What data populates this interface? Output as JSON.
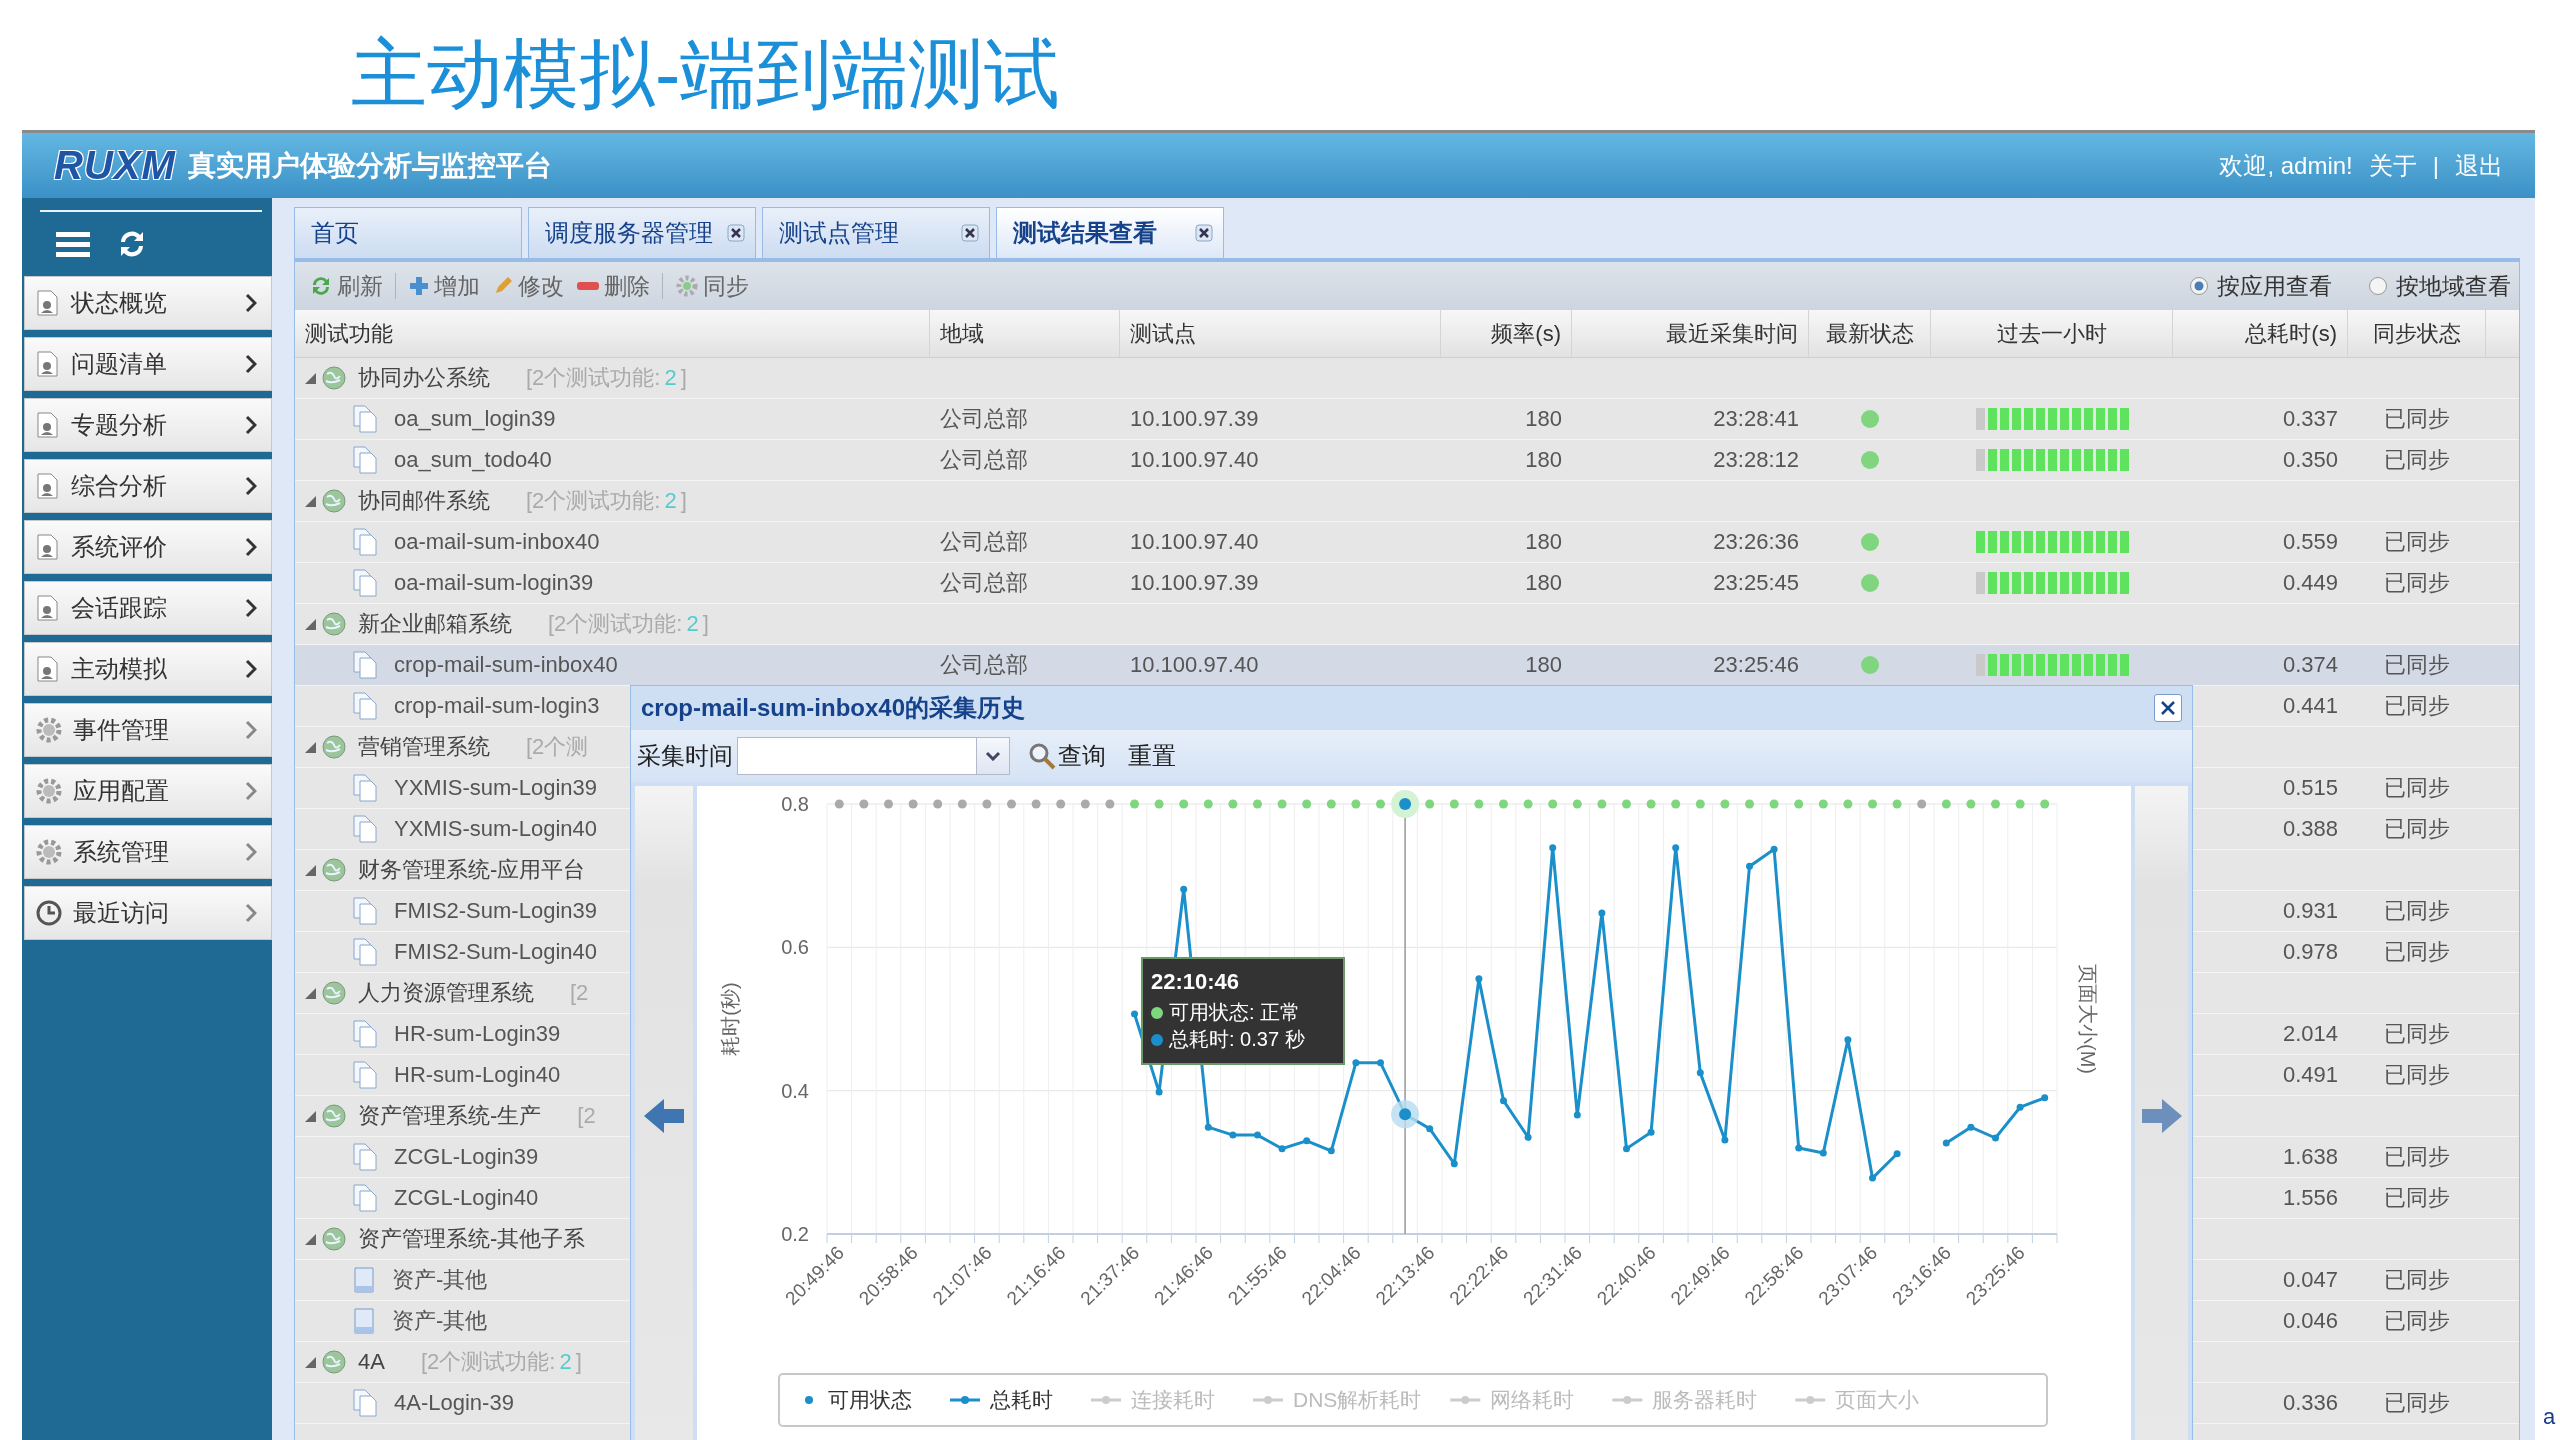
{
  "slide_title": "主动模拟-端到端测试",
  "header": {
    "logo": "RUXM",
    "title": "真实用户体验分析与监控平台",
    "welcome": "欢迎, admin!",
    "links": [
      "关于",
      "退出"
    ],
    "separator": "|"
  },
  "sidebar": {
    "items": [
      {
        "label": "状态概览",
        "kind": "page"
      },
      {
        "label": "问题清单",
        "kind": "page"
      },
      {
        "label": "专题分析",
        "kind": "page"
      },
      {
        "label": "综合分析",
        "kind": "page"
      },
      {
        "label": "系统评价",
        "kind": "page"
      },
      {
        "label": "会话跟踪",
        "kind": "page"
      },
      {
        "label": "主动模拟",
        "kind": "page"
      },
      {
        "label": "事件管理",
        "kind": "gear"
      },
      {
        "label": "应用配置",
        "kind": "gear"
      },
      {
        "label": "系统管理",
        "kind": "gear"
      },
      {
        "label": "最近访问",
        "kind": "clock"
      }
    ]
  },
  "tabs": [
    {
      "label": "首页",
      "closable": false,
      "selected": false
    },
    {
      "label": "调度服务器管理",
      "closable": true,
      "selected": false
    },
    {
      "label": "测试点管理",
      "closable": true,
      "selected": false
    },
    {
      "label": "测试结果查看",
      "closable": true,
      "selected": true
    }
  ],
  "toolbar": {
    "buttons": [
      {
        "label": "刷新",
        "kind": "refresh",
        "separator_before": false
      },
      {
        "label": "增加",
        "kind": "add",
        "separator_before": true
      },
      {
        "label": "修改",
        "kind": "edit",
        "separator_before": false
      },
      {
        "label": "删除",
        "kind": "delete",
        "separator_before": false
      },
      {
        "label": "同步",
        "kind": "sync",
        "separator_before": true
      }
    ],
    "view_options": [
      {
        "label": "按应用查看",
        "selected": true
      },
      {
        "label": "按地域查看",
        "selected": false
      }
    ]
  },
  "table": {
    "columns": [
      "测试功能",
      "地域",
      "测试点",
      "频率(s)",
      "最近采集时间",
      "最新状态",
      "过去一小时",
      "总耗时(s)",
      "同步状态"
    ],
    "groups": [
      {
        "name": "协同办公系统",
        "count_prefix": "[2个测试功能:",
        "count_ok": "2",
        "count_suffix": "]",
        "expanded": true,
        "children": [
          {
            "name": "oa_sum_login39",
            "kind": "doc",
            "region": "公司总部",
            "ip": "10.100.97.39",
            "freq": "180",
            "time": "23:28:41",
            "status_ok": true,
            "history_ok": [
              false,
              true,
              true,
              true,
              true,
              true,
              true,
              true,
              true,
              true,
              true,
              true,
              true
            ],
            "total": "0.337",
            "sync": "已同步",
            "selected": false
          },
          {
            "name": "oa_sum_todo40",
            "kind": "doc",
            "region": "公司总部",
            "ip": "10.100.97.40",
            "freq": "180",
            "time": "23:28:12",
            "status_ok": true,
            "history_ok": [
              false,
              true,
              true,
              true,
              true,
              true,
              true,
              true,
              true,
              true,
              true,
              true,
              true
            ],
            "total": "0.350",
            "sync": "已同步",
            "selected": false
          }
        ]
      },
      {
        "name": "协同邮件系统",
        "count_prefix": "[2个测试功能:",
        "count_ok": "2",
        "count_suffix": "]",
        "expanded": true,
        "children": [
          {
            "name": "oa-mail-sum-inbox40",
            "kind": "doc",
            "region": "公司总部",
            "ip": "10.100.97.40",
            "freq": "180",
            "time": "23:26:36",
            "status_ok": true,
            "history_ok": [
              true,
              true,
              true,
              true,
              true,
              true,
              true,
              true,
              true,
              true,
              true,
              true,
              true
            ],
            "total": "0.559",
            "sync": "已同步",
            "selected": false
          },
          {
            "name": "oa-mail-sum-login39",
            "kind": "doc",
            "region": "公司总部",
            "ip": "10.100.97.39",
            "freq": "180",
            "time": "23:25:45",
            "status_ok": true,
            "history_ok": [
              false,
              true,
              true,
              true,
              true,
              true,
              true,
              true,
              true,
              true,
              true,
              true,
              true
            ],
            "total": "0.449",
            "sync": "已同步",
            "selected": false
          }
        ]
      },
      {
        "name": "新企业邮箱系统",
        "count_prefix": "[2个测试功能:",
        "count_ok": "2",
        "count_suffix": "]",
        "expanded": true,
        "children": [
          {
            "name": "crop-mail-sum-inbox40",
            "kind": "doc",
            "region": "公司总部",
            "ip": "10.100.97.40",
            "freq": "180",
            "time": "23:25:46",
            "status_ok": true,
            "history_ok": [
              false,
              true,
              true,
              true,
              true,
              true,
              true,
              true,
              true,
              true,
              true,
              true,
              true
            ],
            "total": "0.374",
            "sync": "已同步",
            "selected": true
          },
          {
            "name": "crop-mail-sum-login3",
            "kind": "doc",
            "total": "0.441",
            "sync": "已同步",
            "selected": false
          }
        ]
      },
      {
        "name": "营销管理系统",
        "count_prefix": "[2个测",
        "expanded": true,
        "children": [
          {
            "name": "YXMIS-sum-Login39",
            "kind": "doc",
            "total": "0.515",
            "sync": "已同步",
            "selected": false
          },
          {
            "name": "YXMIS-sum-Login40",
            "kind": "doc",
            "total": "0.388",
            "sync": "已同步",
            "selected": false
          }
        ]
      },
      {
        "name": "财务管理系统-应用平台",
        "expanded": true,
        "children": [
          {
            "name": "FMIS2-Sum-Login39",
            "kind": "doc",
            "total": "0.931",
            "sync": "已同步",
            "selected": false
          },
          {
            "name": "FMIS2-Sum-Login40",
            "kind": "doc",
            "total": "0.978",
            "sync": "已同步",
            "selected": false
          }
        ]
      },
      {
        "name": "人力资源管理系统",
        "count_prefix": "[2",
        "expanded": true,
        "children": [
          {
            "name": "HR-sum-Login39",
            "kind": "doc",
            "total": "2.014",
            "sync": "已同步",
            "selected": false
          },
          {
            "name": "HR-sum-Login40",
            "kind": "doc",
            "total": "0.491",
            "sync": "已同步",
            "selected": false
          }
        ]
      },
      {
        "name": "资产管理系统-生产",
        "count_prefix": "[2",
        "expanded": true,
        "children": [
          {
            "name": "ZCGL-Login39",
            "kind": "doc",
            "total": "1.638",
            "sync": "已同步",
            "selected": false
          },
          {
            "name": "ZCGL-Login40",
            "kind": "doc",
            "total": "1.556",
            "sync": "已同步",
            "selected": false
          }
        ]
      },
      {
        "name": "资产管理系统-其他子系",
        "expanded": true,
        "children": [
          {
            "name": "资产-其他",
            "kind": "sheet",
            "total": "0.047",
            "sync": "已同步",
            "selected": false
          },
          {
            "name": "资产-其他",
            "kind": "sheet",
            "total": "0.046",
            "sync": "已同步",
            "selected": false
          }
        ]
      },
      {
        "name": "4A",
        "count_prefix": "[2个测试功能:",
        "count_ok": "2",
        "count_suffix": "]",
        "expanded": true,
        "children": [
          {
            "name": "4A-Login-39",
            "kind": "doc",
            "total": "0.336",
            "sync": "已同步",
            "selected": false
          }
        ]
      }
    ]
  },
  "popup": {
    "title": "crop-mail-sum-inbox40的采集历史",
    "filter_label": "采集时间",
    "buttons": [
      {
        "label": "查询",
        "kind": "search"
      },
      {
        "label": "重置",
        "kind": "plain"
      }
    ],
    "chart": {
      "chart_data": {
        "type": "line",
        "ylabel": "耗时(秒)",
        "categories": [
          "20:49:46",
          null,
          null,
          "20:58:46",
          null,
          null,
          "21:07:46",
          null,
          null,
          "21:16:46",
          null,
          null,
          "21:37:46",
          null,
          null,
          "21:46:46",
          null,
          null,
          "21:55:46",
          null,
          null,
          "22:04:46",
          null,
          null,
          "22:13:46",
          null,
          null,
          "22:22:46",
          null,
          null,
          "22:31:46",
          null,
          null,
          "22:40:46",
          null,
          null,
          "22:49:46",
          null,
          null,
          "22:58:46",
          null,
          null,
          "23:07:46",
          null,
          null,
          "23:16:46",
          null,
          null,
          "23:25:46",
          null
        ],
        "series": [
          {
            "name": "总耗时",
            "color": "#1a8fc9",
            "marker": true,
            "values": [
              null,
              null,
              null,
              null,
              null,
              null,
              null,
              null,
              null,
              null,
              null,
              null,
              0.507,
              0.398,
              0.681,
              0.349,
              0.338,
              0.338,
              0.319,
              0.33,
              0.316,
              0.439,
              0.439,
              0.367,
              0.347,
              0.298,
              0.556,
              0.386,
              0.335,
              0.739,
              0.366,
              0.648,
              0.319,
              0.342,
              0.739,
              0.425,
              0.331,
              0.713,
              0.737,
              0.32,
              0.313,
              0.471,
              0.278,
              0.312,
              null,
              0.327,
              0.349,
              0.334,
              0.377,
              0.39
            ]
          }
        ],
        "ylim": [
          0.2,
          0.8
        ],
        "yticks": [
          0.2,
          0.4,
          0.6,
          0.8
        ]
      },
      "right_axis_label": "页面大小(M)",
      "available": [
        false,
        false,
        false,
        false,
        false,
        false,
        false,
        false,
        false,
        false,
        false,
        false,
        true,
        true,
        true,
        true,
        true,
        true,
        true,
        true,
        true,
        true,
        true,
        true,
        true,
        true,
        true,
        true,
        true,
        true,
        true,
        true,
        true,
        true,
        true,
        true,
        true,
        true,
        true,
        true,
        true,
        true,
        true,
        true,
        false,
        true,
        true,
        true,
        true,
        true
      ],
      "hovered": [
        false,
        false,
        false,
        false,
        false,
        false,
        false,
        false,
        false,
        false,
        false,
        false,
        false,
        false,
        false,
        false,
        false,
        false,
        false,
        false,
        false,
        false,
        false,
        true,
        false,
        false,
        false,
        false,
        false,
        false,
        false,
        false,
        false,
        false,
        false,
        false,
        false,
        false,
        false,
        false,
        false,
        false,
        false,
        false,
        false,
        false,
        false,
        false,
        false,
        false
      ],
      "tooltip": {
        "time": "22:10:46",
        "lines": [
          {
            "label": "可用状态: 正常",
            "color": "#7ed67e"
          },
          {
            "label": "总耗时: 0.37 秒",
            "color": "#1a8fc9"
          }
        ]
      },
      "legend": [
        {
          "label": "可用状态",
          "kind": "dot",
          "active": true
        },
        {
          "kind": "series",
          "active": true
        },
        {
          "label": "连接耗时",
          "kind": "line",
          "active": false
        },
        {
          "label": "DNS解析耗时",
          "kind": "line",
          "active": false
        },
        {
          "label": "网络耗时",
          "kind": "line",
          "active": false
        },
        {
          "label": "服务器耗时",
          "kind": "line",
          "active": false
        },
        {
          "label": "页面大小",
          "kind": "line",
          "active": false
        }
      ]
    }
  },
  "edge_fragment": "a"
}
